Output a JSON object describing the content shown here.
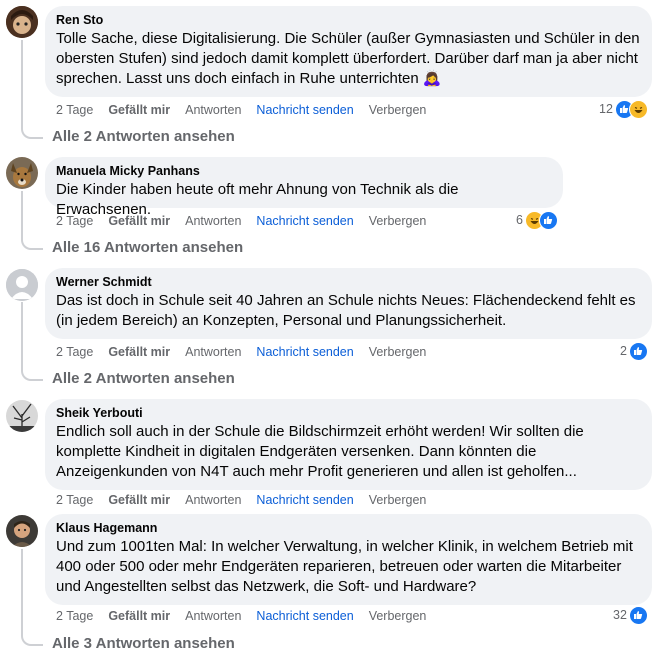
{
  "comments": [
    {
      "author": "Ren Sto",
      "text": "Tolle Sache, diese Digitalisierung. Die Schüler (außer Gymnasiasten und Schüler in den obersten Stufen) sind jedoch damit komplett überfordert. Darüber darf man ja aber nicht sprechen. Lasst uns doch einfach in Ruhe unterrichten 🙇‍♀️",
      "time": "2 Tage",
      "like": "Gefällt mir",
      "reply": "Antworten",
      "message": "Nachricht senden",
      "hide": "Verbergen",
      "reaction_count": "12",
      "reactions": [
        "like-icon",
        "haha-icon"
      ],
      "replies_link": "Alle 2 Antworten ansehen"
    },
    {
      "author": "Manuela Micky Panhans",
      "text": "Die Kinder haben heute oft mehr Ahnung von Technik als die Erwachsenen.",
      "time": "2 Tage",
      "like": "Gefällt mir",
      "reply": "Antworten",
      "message": "Nachricht senden",
      "hide": "Verbergen",
      "reaction_count": "6",
      "reactions": [
        "haha-icon",
        "like-icon"
      ],
      "replies_link": "Alle 16 Antworten ansehen"
    },
    {
      "author": "Werner Schmidt",
      "text": "Das ist doch in Schule seit 40 Jahren an Schule nichts Neues: Flächendeckend fehlt es (in jedem Bereich) an Konzepten, Personal und Planungssicherheit.",
      "time": "2 Tage",
      "like": "Gefällt mir",
      "reply": "Antworten",
      "message": "Nachricht senden",
      "hide": "Verbergen",
      "reaction_count": "2",
      "reactions": [
        "like-icon"
      ],
      "replies_link": "Alle 2 Antworten ansehen"
    },
    {
      "author": "Sheik Yerbouti",
      "text": "Endlich soll auch in der Schule die Bildschirmzeit erhöht werden! Wir sollten die komplette Kindheit in digitalen Endgeräten versenken. Dann könnten die Anzeigenkunden von N4T auch mehr Profit generieren und allen ist geholfen...",
      "time": "2 Tage",
      "like": "Gefällt mir",
      "reply": "Antworten",
      "message": "Nachricht senden",
      "hide": "Verbergen"
    },
    {
      "author": "Klaus Hagemann",
      "text": "Und zum 1001ten Mal: In welcher Verwaltung, in welcher Klinik, in welchem Betrieb mit 400 oder 500 oder mehr Endgeräten reparieren, betreuen oder warten die Mitarbeiter und Angestellten selbst das Netzwerk, die Soft- und Hardware?",
      "time": "2 Tage",
      "like": "Gefällt mir",
      "reply": "Antworten",
      "message": "Nachricht senden",
      "hide": "Verbergen",
      "reaction_count": "32",
      "reactions": [
        "like-icon"
      ],
      "replies_link": "Alle 3 Antworten ansehen"
    }
  ],
  "colors": {
    "bubble": "#f0f2f5",
    "link_blue": "#0b5ed7",
    "muted": "#65676b",
    "like_blue": "#1877f2",
    "haha_yellow": "#f7b928"
  }
}
